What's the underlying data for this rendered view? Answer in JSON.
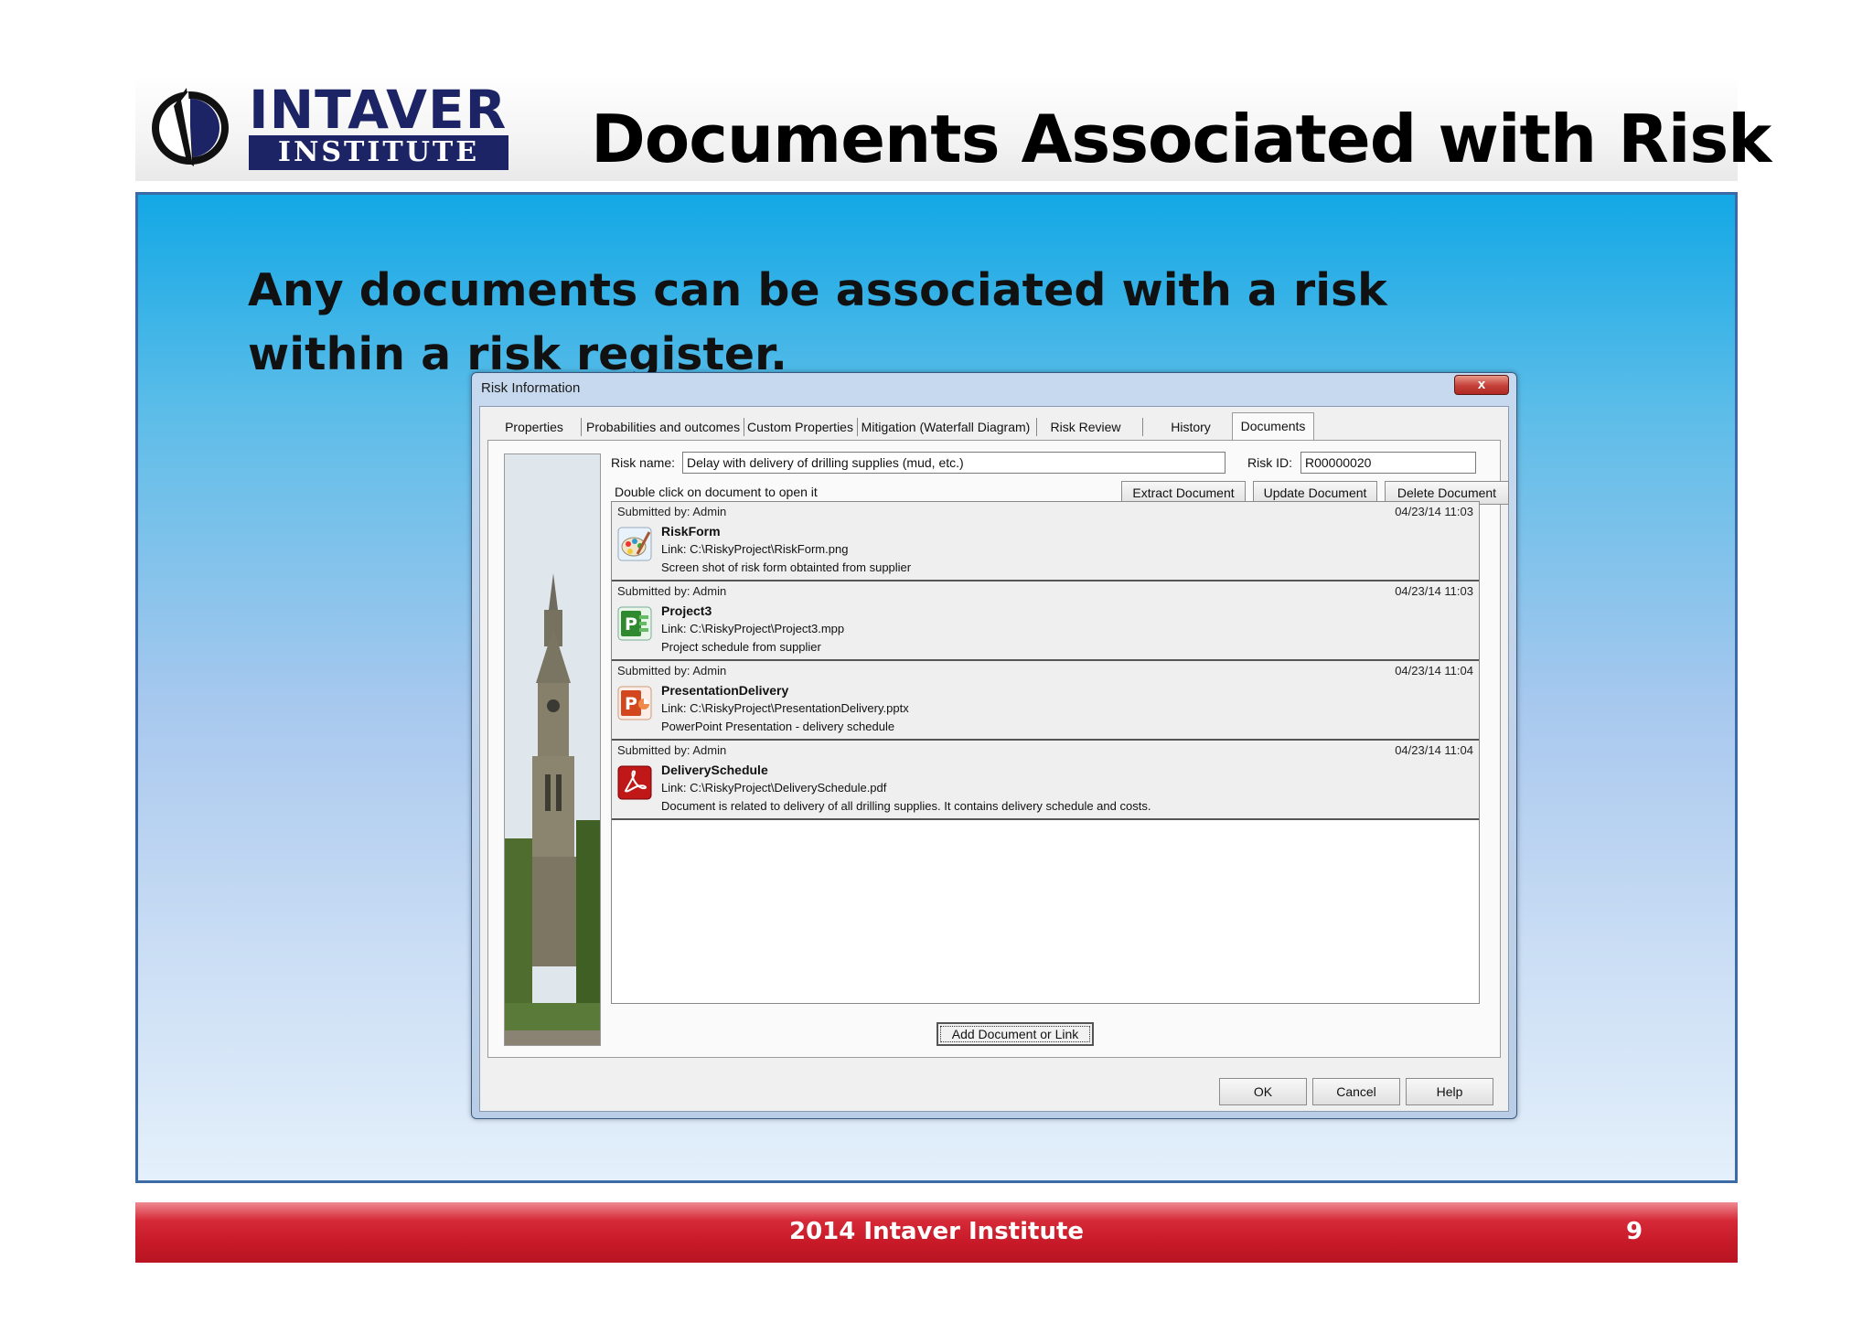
{
  "header": {
    "logo_top": "INTAVER",
    "logo_bottom": "INSTITUTE",
    "title": "Documents Associated with Risk"
  },
  "subtitle": "Any documents can be associated with a risk within a risk register.",
  "dialog": {
    "title": "Risk Information",
    "close_label": "x",
    "tabs": [
      {
        "label": "Properties"
      },
      {
        "label": "Probabilities and outcomes"
      },
      {
        "label": "Custom Properties"
      },
      {
        "label": "Mitigation (Waterfall Diagram)"
      },
      {
        "label": "Risk Review"
      },
      {
        "label": "History"
      },
      {
        "label": "Documents"
      }
    ],
    "risk_name_label": "Risk name:",
    "risk_name_value": "Delay with delivery of drilling supplies (mud, etc.)",
    "risk_id_label": "Risk ID:",
    "risk_id_value": "R00000020",
    "hint": "Double click on document to open it",
    "extract_label": "Extract Document",
    "update_label": "Update Document",
    "delete_label": "Delete Document",
    "documents": [
      {
        "submitted": "Submitted by: Admin",
        "date": "04/23/14 11:03",
        "name": "RiskForm",
        "link": "Link: C:\\RiskyProject\\RiskForm.png",
        "description": "Screen shot of risk form obtainted from supplier",
        "icon": "paint-icon",
        "color": "#e8f2fb"
      },
      {
        "submitted": "Submitted by: Admin",
        "date": "04/23/14 11:03",
        "name": "Project3",
        "link": "Link: C:\\RiskyProject\\Project3.mpp",
        "description": "Project schedule from supplier",
        "icon": "project-icon",
        "color": "#2f8a2f"
      },
      {
        "submitted": "Submitted by: Admin",
        "date": "04/23/14 11:04",
        "name": "PresentationDelivery",
        "link": "Link: C:\\RiskyProject\\PresentationDelivery.pptx",
        "description": "PowerPoint Presentation - delivery schedule",
        "icon": "powerpoint-icon",
        "color": "#d2471e"
      },
      {
        "submitted": "Submitted by: Admin",
        "date": "04/23/14 11:04",
        "name": "DeliverySchedule",
        "link": "Link: C:\\RiskyProject\\DeliverySchedule.pdf",
        "description": "Document is related to delivery of all drilling supplies. It contains delivery schedule and costs.",
        "icon": "pdf-icon",
        "color": "#c01818"
      }
    ],
    "add_label": "Add Document or Link",
    "ok_label": "OK",
    "cancel_label": "Cancel",
    "help_label": "Help"
  },
  "footer": {
    "text": "2014 Intaver Institute",
    "page": "9"
  }
}
